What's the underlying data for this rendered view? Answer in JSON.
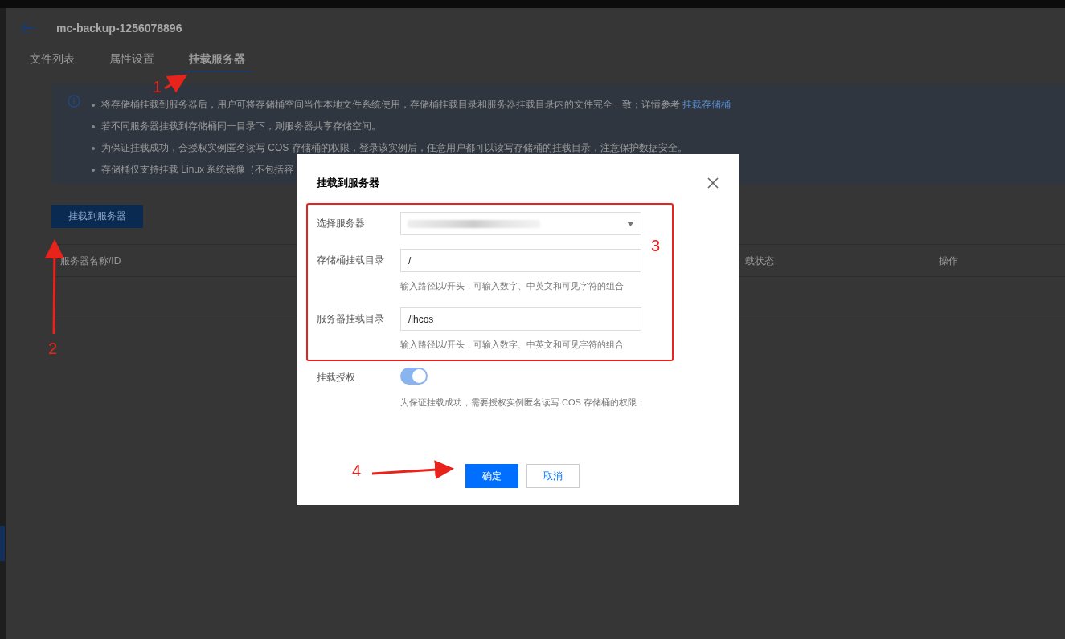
{
  "header": {
    "title": "mc-backup-1256078896"
  },
  "tabs": [
    {
      "label": "文件列表",
      "selected": false
    },
    {
      "label": "属性设置",
      "selected": false
    },
    {
      "label": "挂载服务器",
      "selected": true
    }
  ],
  "notice": {
    "items": [
      {
        "text": "将存储桶挂载到服务器后，用户可将存储桶空间当作本地文件系统使用，存储桶挂载目录和服务器挂载目录内的文件完全一致；详情参考 ",
        "link": "挂载存储桶"
      },
      {
        "text": "若不同服务器挂载到存储桶同一目录下，则服务器共享存储空间。"
      },
      {
        "text": "为保证挂载成功，会授权实例匿名读写 COS 存储桶的权限，登录该实例后，任意用户都可以读写存储桶的挂载目录，注意保护数据安全。"
      },
      {
        "text": "存储桶仅支持挂载 Linux 系统镜像（不包括容"
      }
    ]
  },
  "mount_button": "挂载到服务器",
  "table": {
    "columns": [
      "服务器名称/ID",
      "载状态",
      "操作"
    ]
  },
  "dialog": {
    "title": "挂载到服务器",
    "fields": [
      {
        "kind": "select",
        "label": "选择服务器"
      },
      {
        "kind": "input",
        "label": "存储桶挂载目录",
        "value": "/",
        "hint": "输入路径以/开头，可输入数字、中英文和可见字符的组合"
      },
      {
        "kind": "input",
        "label": "服务器挂载目录",
        "value": "/lhcos",
        "hint": "输入路径以/开头，可输入数字、中英文和可见字符的组合"
      },
      {
        "kind": "switch",
        "label": "挂载授权",
        "on": true,
        "hint": "为保证挂载成功，需要授权实例匿名读写 COS 存储桶的权限；"
      }
    ],
    "buttons": [
      {
        "label": "确定",
        "kind": "primary"
      },
      {
        "label": "取消",
        "kind": "secondary"
      }
    ]
  },
  "annotations": [
    {
      "label": "1"
    },
    {
      "label": "2"
    },
    {
      "label": "3"
    },
    {
      "label": "4"
    }
  ]
}
